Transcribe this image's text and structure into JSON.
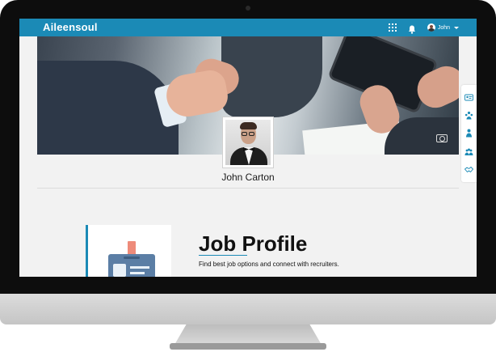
{
  "app": {
    "brand": "Aileensoul"
  },
  "topbar": {
    "user_name": "John",
    "colors": {
      "bar": "#1b8ab6"
    }
  },
  "profile": {
    "name": "John Carton"
  },
  "side_menu": {
    "items": [
      "id-card-icon",
      "team-icon",
      "person-icon",
      "group-icon",
      "handshake-icon"
    ]
  },
  "job_section": {
    "title": "Job Profile",
    "subtitle": "Find best job options and connect with recruiters."
  }
}
